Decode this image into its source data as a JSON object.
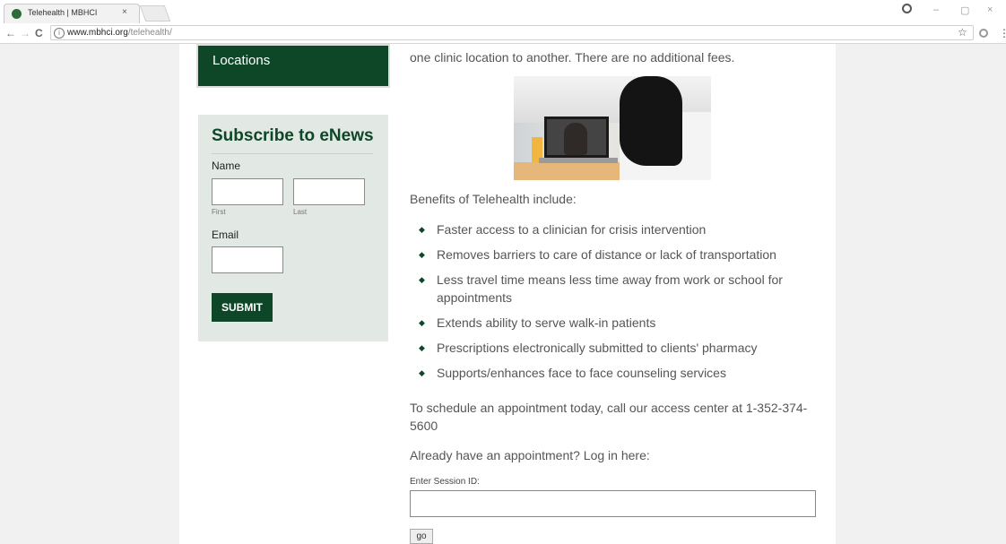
{
  "browser": {
    "tab_title": "Telehealth | MBHCI",
    "tab_close": "×",
    "url_host": "www.mbhci.org",
    "url_path": "/telehealth/",
    "back": "←",
    "forward": "→",
    "reload": "C",
    "star": "☆",
    "menu": "⋮",
    "minimize": "–",
    "restore": "▢",
    "close": "×"
  },
  "sidebar": {
    "locations_label": "Locations",
    "subscribe_title": "Subscribe to eNews",
    "name_label": "Name",
    "first_label": "First",
    "last_label": "Last",
    "email_label": "Email",
    "first_value": "",
    "last_value": "",
    "email_value": "",
    "submit_label": "SUBMIT"
  },
  "main": {
    "intro": "one clinic location to another.  There are no additional fees.",
    "benefits_heading": "Benefits of Telehealth include:",
    "benefits": [
      "Faster access to a clinician for crisis intervention",
      "Removes barriers to care of distance or lack of transportation",
      "Less travel time means less time away from work or school for appointments",
      "Extends ability to serve walk-in patients",
      "Prescriptions electronically submitted to clients' pharmacy",
      "Supports/enhances face to face counseling services"
    ],
    "schedule": "To schedule an appointment today, call our access center at 1-352-374-5600",
    "login_prompt": "Already have an appointment? Log in here:",
    "session_label": "Enter Session ID:",
    "session_value": "",
    "go_label": "go"
  },
  "colors": {
    "brand_green": "#0e4727",
    "sidebar_bg": "#e2e8e3"
  }
}
